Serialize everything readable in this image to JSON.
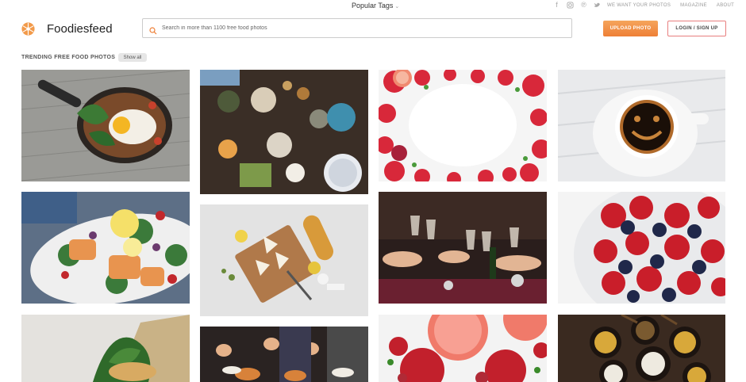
{
  "topbar": {
    "popular_tags": "Popular Tags",
    "social_icons": [
      "facebook-icon",
      "instagram-icon",
      "pinterest-icon",
      "twitter-icon"
    ],
    "links": [
      "WE WANT YOUR PHOTOS",
      "MAGAZINE",
      "ABOUT"
    ]
  },
  "header": {
    "brand": "Foodiesfeed",
    "search_placeholder": "Search in more than 1100 free food photos",
    "upload_label": "UPLOAD PHOTO",
    "login_label": "LOGIN / SIGN UP"
  },
  "section": {
    "title": "TRENDING FREE FOOD PHOTOS",
    "show_all": "Show all"
  },
  "photos": [
    "egg-skillet-photo",
    "party-table-photo",
    "strawberry-frame-photo",
    "coffee-smile-photo",
    "salmon-salad-photo",
    "cheese-board-photo",
    "wine-toast-photo",
    "berries-bowl-photo",
    "greens-cheese-photo",
    "buffet-people-photo",
    "grapefruit-apples-photo",
    "asian-bowls-photo"
  ],
  "colors": {
    "accent": "#ee7f36",
    "login_border": "#e87e7e"
  }
}
